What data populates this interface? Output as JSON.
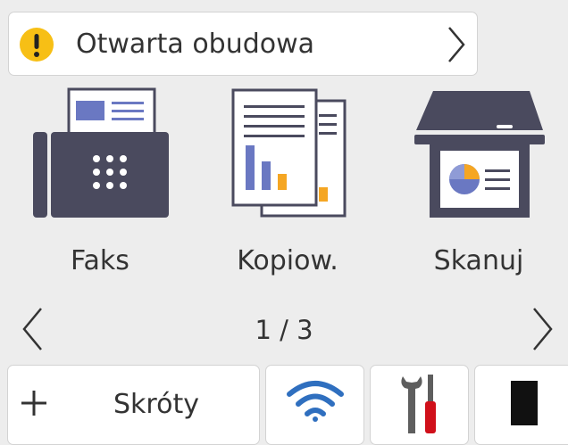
{
  "status_alert": {
    "message": "Otwarta obudowa",
    "icon": "warning-icon",
    "icon_color": "#f7bf15"
  },
  "apps": [
    {
      "id": "fax",
      "label": "Faks",
      "icon": "fax-icon"
    },
    {
      "id": "copy",
      "label": "Kopiow.",
      "icon": "copy-icon"
    },
    {
      "id": "scan",
      "label": "Skanuj",
      "icon": "scan-icon"
    }
  ],
  "pager": {
    "current": 1,
    "total": 3,
    "label": "1 / 3"
  },
  "bottom_bar": {
    "shortcuts_label": "Skróty",
    "wifi_icon": "wifi-icon",
    "settings_icon": "tools-icon",
    "ink_icon": "ink-cartridge-icon"
  },
  "colors": {
    "icon_dark": "#4a4a5e",
    "accent_blue": "#6a78c2",
    "accent_orange": "#f5a623",
    "warning_yellow": "#f7bf15",
    "tool_red": "#d0101a"
  }
}
